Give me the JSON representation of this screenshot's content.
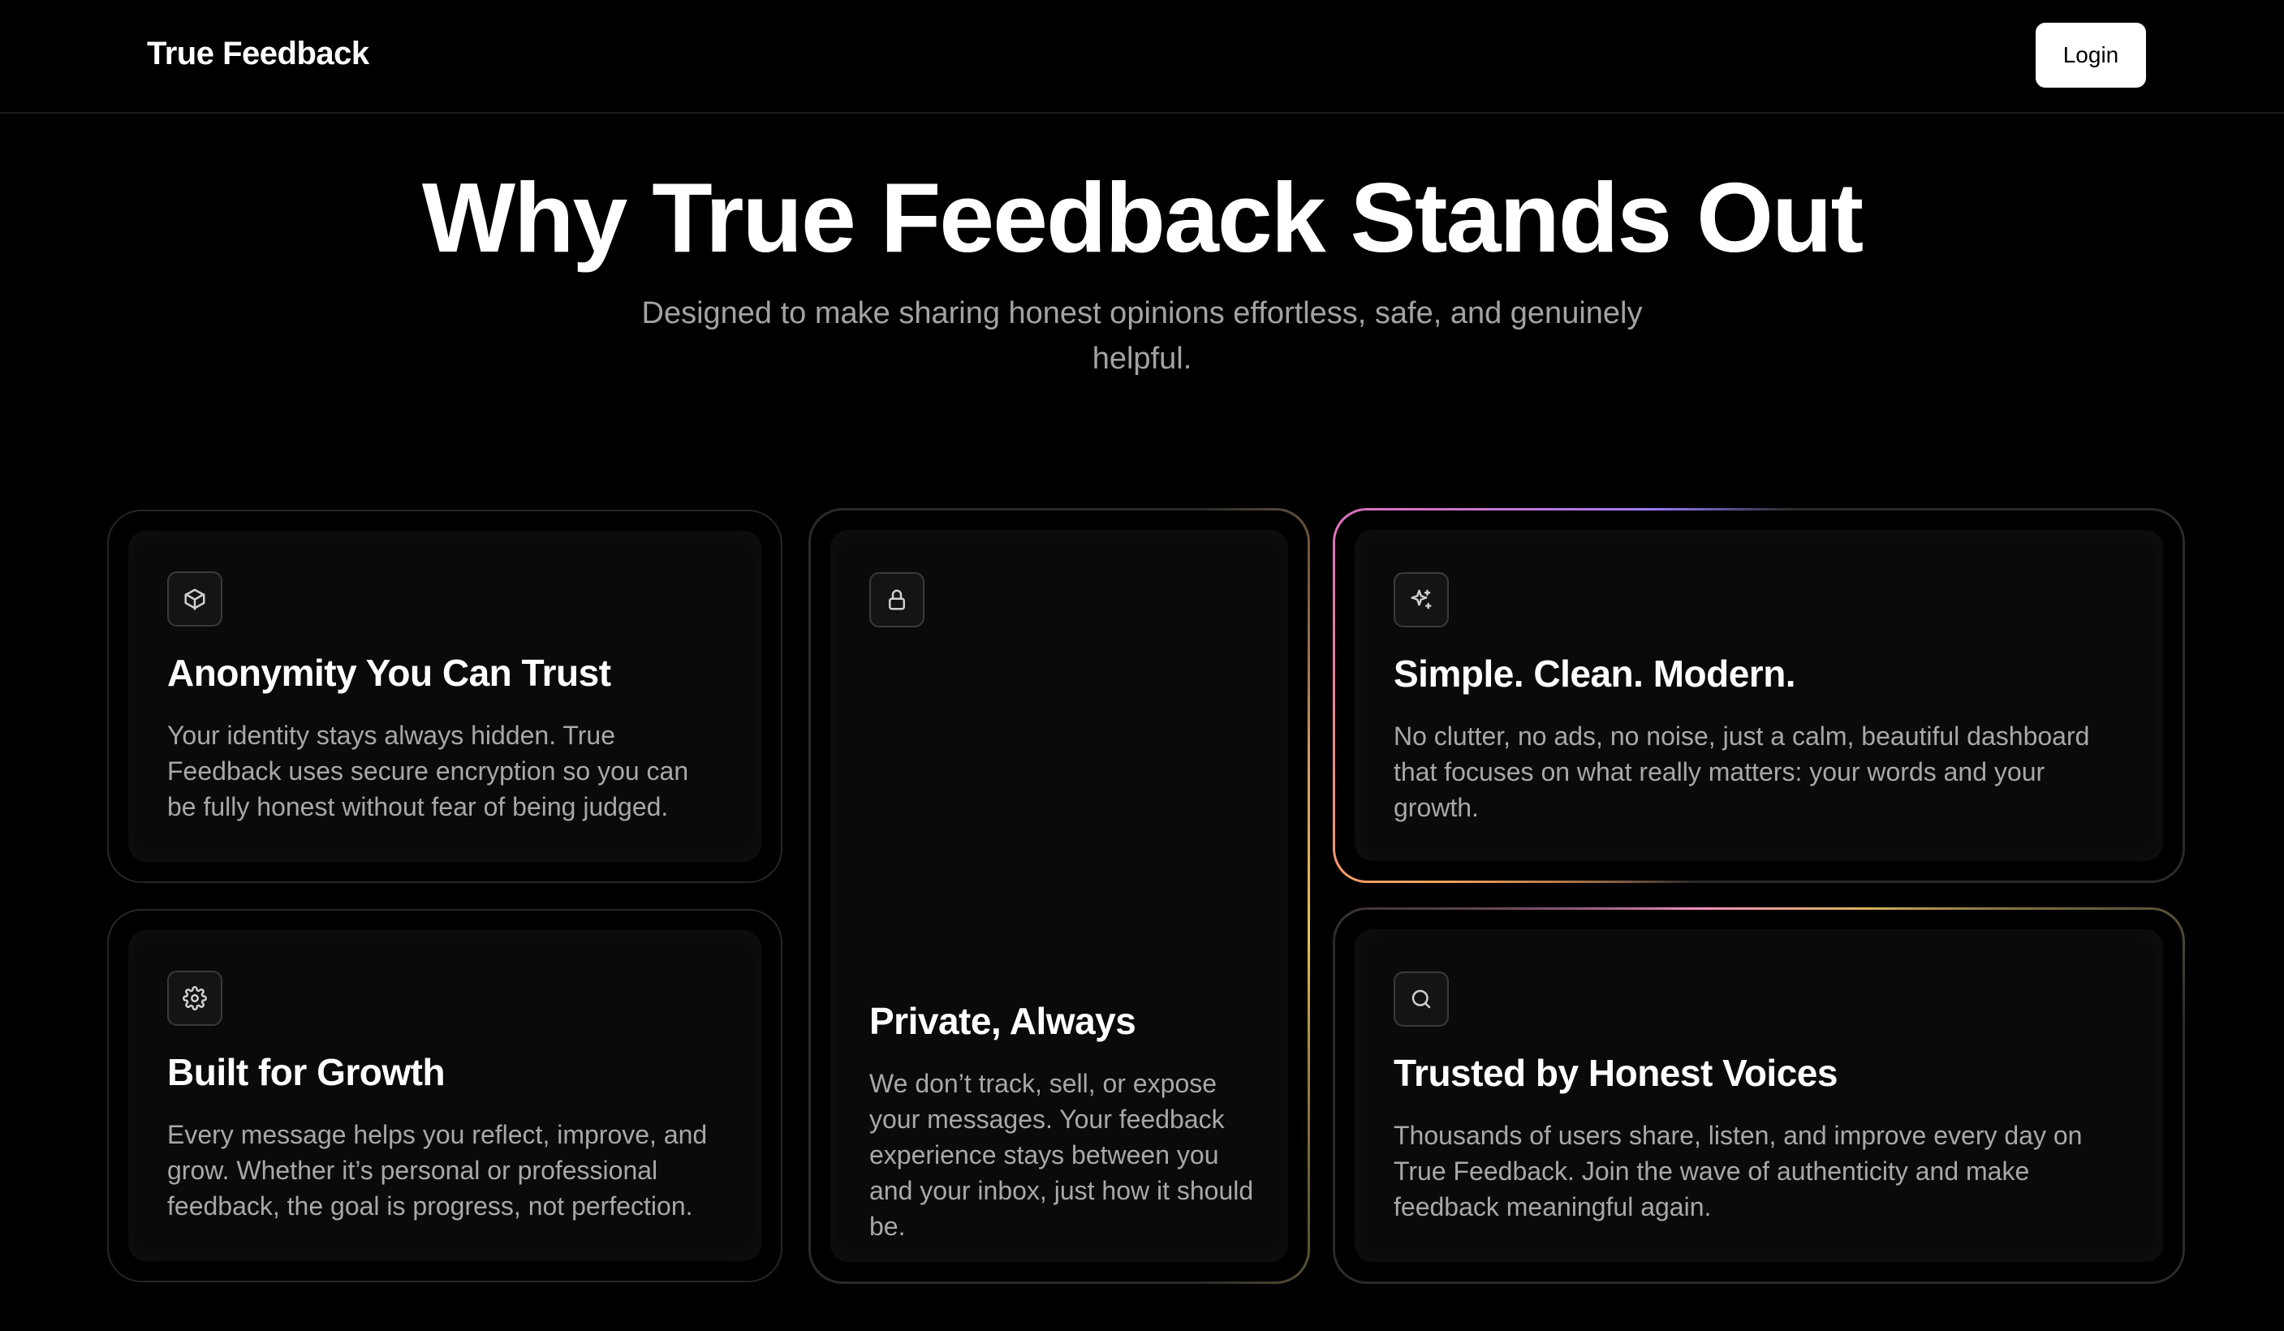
{
  "header": {
    "brand": "True Feedback",
    "login_label": "Login"
  },
  "hero": {
    "title": "Why True Feedback Stands Out",
    "subtitle": "Designed to make sharing honest opinions effortless, safe, and genuinely helpful."
  },
  "features": [
    {
      "icon": "cube-icon",
      "title": "Anonymity You Can Trust",
      "description": "Your identity stays always hidden. True Feedback uses secure encryption so you can be fully honest without fear of being judged."
    },
    {
      "icon": "lock-icon",
      "title": "Private, Always",
      "description": "We don’t track, sell, or expose your messages. Your feedback experience stays between you and your inbox, just how it should be."
    },
    {
      "icon": "sparkles-icon",
      "title": "Simple. Clean. Modern.",
      "description": "No clutter, no ads, no noise, just a calm, beautiful dashboard that focuses on what really matters: your words and your growth."
    },
    {
      "icon": "gear-icon",
      "title": "Built for Growth",
      "description": "Every message helps you reflect, improve, and grow. Whether it’s personal or professional feedback, the goal is progress, not perfection."
    },
    {
      "icon": "search-icon",
      "title": "Trusted by Honest Voices",
      "description": "Thousands of users share, listen, and improve every day on True Feedback. Join the wave of authenticity and make feedback meaningful again."
    }
  ],
  "colors": {
    "background": "#000000",
    "card_fill": "#0a0a0a",
    "subtitle_text": "#a3a3a3",
    "glow_orange": "#f5a25d",
    "glow_pink": "#e06fb6",
    "glow_gold": "#e8c44a"
  }
}
